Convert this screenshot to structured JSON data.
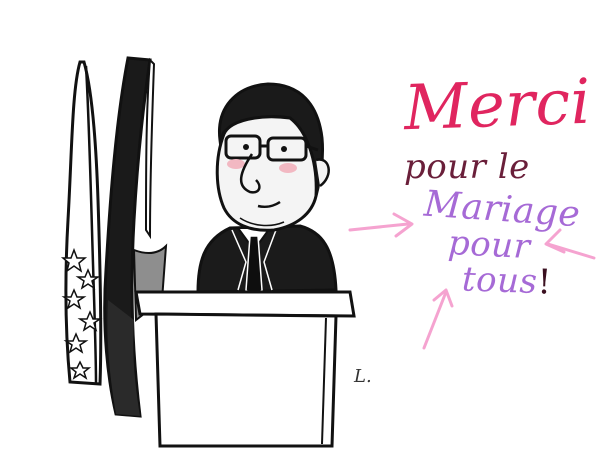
{
  "message": {
    "line1": "Merci",
    "line2": "pour le",
    "line3": "Mariage",
    "line4": "pour",
    "line5": "tous",
    "exclamation": "!"
  },
  "signature": "L.",
  "colors": {
    "merci": "#e0255f",
    "pour_le": "#6a1f3a",
    "mariage_pour_tous": "#a66ad6",
    "arrows": "#f5a3d0",
    "ink": "#111111",
    "suit": "#1b1b1b",
    "skin": "#f4f4f4",
    "cheeks": "#f2b8c2"
  },
  "icons": [
    "arrow-right-icon",
    "arrow-left-icon",
    "arrow-up-icon",
    "flag-icon",
    "podium-icon"
  ]
}
